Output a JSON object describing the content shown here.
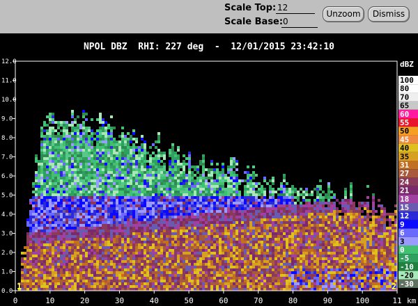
{
  "toolbar": {
    "scale_top_label": "Scale Top:",
    "scale_top_value": "12",
    "scale_base_label": "Scale Base:",
    "scale_base_value": "0",
    "unzoom_label": "Unzoom",
    "dismiss_label": "Dismiss"
  },
  "title": "NPOL DBZ  RHI: 227 deg  -  12/01/2015 23:42:10",
  "chart_data": {
    "type": "heatmap",
    "title": "NPOL DBZ  RHI: 227 deg  -  12/01/2015 23:42:10",
    "x_ticks": [
      "0",
      "10",
      "20",
      "30",
      "40",
      "50",
      "60",
      "70",
      "80",
      "90",
      "100",
      "11"
    ],
    "x_unit": "km",
    "xlim": [
      0,
      110
    ],
    "y_ticks": [
      "0.0",
      "1.0",
      "2.0",
      "3.0",
      "4.0",
      "5.0",
      "6.0",
      "7.0",
      "8.0",
      "9.0",
      "10.0",
      "11.0",
      "12.0"
    ],
    "ylim": [
      0,
      12
    ],
    "markers": [
      "1",
      "2"
    ],
    "legend_unit": "dBZ",
    "legend": [
      {
        "label": "100",
        "color": "#ffffff"
      },
      {
        "label": "80",
        "color": "#ffffff"
      },
      {
        "label": "70",
        "color": "#efefef"
      },
      {
        "label": "65",
        "color": "#c8c8c8"
      },
      {
        "label": "60",
        "color": "#ff1aa0"
      },
      {
        "label": "55",
        "color": "#e8152c"
      },
      {
        "label": "50",
        "color": "#f5a020"
      },
      {
        "label": "45",
        "color": "#f08a40"
      },
      {
        "label": "40",
        "color": "#e0c020"
      },
      {
        "label": "35",
        "color": "#d8a020"
      },
      {
        "label": "31",
        "color": "#c07020"
      },
      {
        "label": "27",
        "color": "#a85a3a"
      },
      {
        "label": "24",
        "color": "#8a3a5a"
      },
      {
        "label": "21",
        "color": "#7a2a6a"
      },
      {
        "label": "18",
        "color": "#a040a0"
      },
      {
        "label": "15",
        "color": "#6a5ab0"
      },
      {
        "label": "12",
        "color": "#2a2ad8"
      },
      {
        "label": "9",
        "color": "#0a0aff"
      },
      {
        "label": "6",
        "color": "#6a6aff"
      },
      {
        "label": "3",
        "color": "#9a9aff"
      },
      {
        "label": "0",
        "color": "#40c070"
      },
      {
        "label": "-5",
        "color": "#30a060"
      },
      {
        "label": "-10",
        "color": "#208040"
      },
      {
        "label": "-20",
        "color": "#a8e8b8"
      },
      {
        "label": "-30",
        "color": "#607060"
      }
    ]
  }
}
